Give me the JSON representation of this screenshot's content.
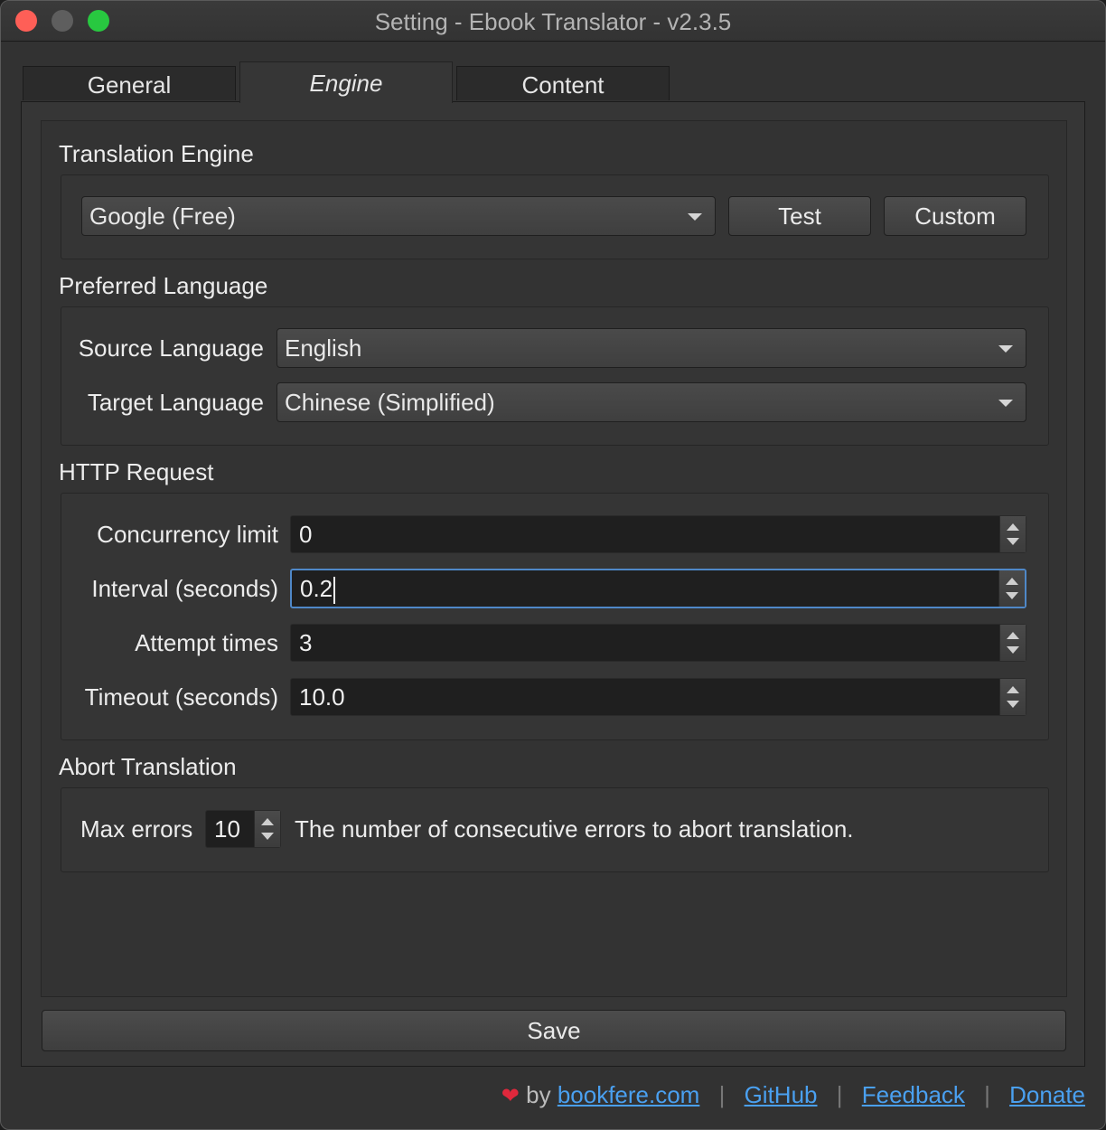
{
  "window": {
    "title": "Setting - Ebook Translator - v2.3.5"
  },
  "tabs": [
    {
      "label": "General"
    },
    {
      "label": "Engine"
    },
    {
      "label": "Content"
    }
  ],
  "translation_engine": {
    "title": "Translation Engine",
    "engine_value": "Google (Free)",
    "test_label": "Test",
    "custom_label": "Custom"
  },
  "preferred_language": {
    "title": "Preferred Language",
    "source_label": "Source Language",
    "source_value": "English",
    "target_label": "Target Language",
    "target_value": "Chinese (Simplified)"
  },
  "http_request": {
    "title": "HTTP Request",
    "concurrency_label": "Concurrency limit",
    "concurrency_value": "0",
    "interval_label": "Interval (seconds)",
    "interval_value": "0.2",
    "attempt_label": "Attempt times",
    "attempt_value": "3",
    "timeout_label": "Timeout (seconds)",
    "timeout_value": "10.0"
  },
  "abort_translation": {
    "title": "Abort Translation",
    "max_errors_label": "Max errors",
    "max_errors_value": "10",
    "description": "The number of consecutive errors to abort translation."
  },
  "save_label": "Save",
  "footer": {
    "by": "by",
    "links": [
      "bookfere.com",
      "GitHub",
      "Feedback",
      "Donate"
    ],
    "separator": "|"
  },
  "colors": {
    "link": "#4aa0f0",
    "heart": "#e0283c",
    "focus": "#4f88c8"
  }
}
